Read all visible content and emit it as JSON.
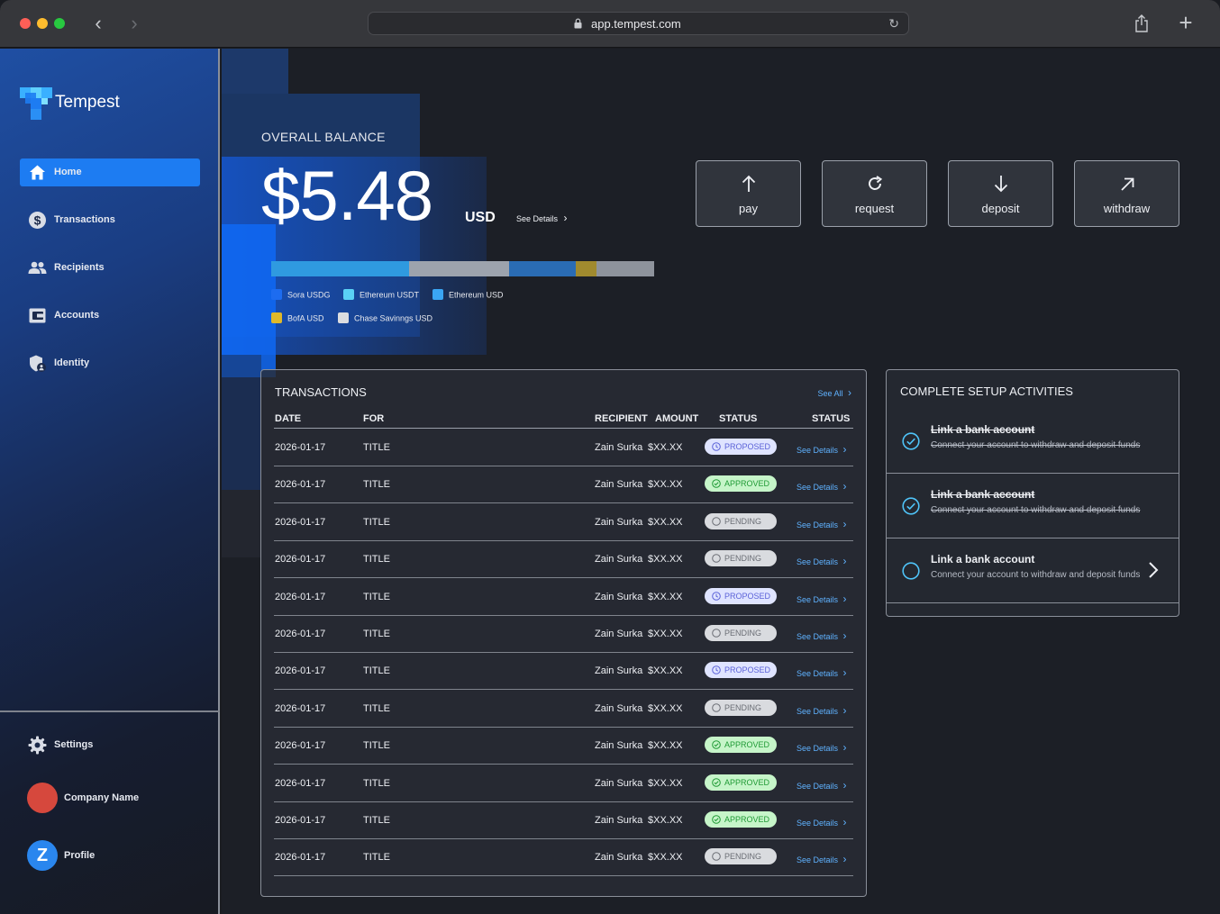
{
  "browser": {
    "url": "app.tempest.com"
  },
  "sidebar": {
    "brand": "Tempest",
    "items": [
      {
        "label": "Home",
        "icon": "home-icon",
        "active": true
      },
      {
        "label": "Transactions",
        "icon": "dollar-icon"
      },
      {
        "label": "Recipients",
        "icon": "people-icon"
      },
      {
        "label": "Accounts",
        "icon": "wallet-icon"
      },
      {
        "label": "Identity",
        "icon": "shield-user-icon"
      }
    ],
    "settings_label": "Settings",
    "company_label": "Company Name",
    "profile_label": "Profile",
    "profile_initial": "Z"
  },
  "balance": {
    "title": "OVERALL BALANCE",
    "amount": "$5.48",
    "currency": "USD",
    "see_details": "See Details",
    "breakdown": [
      {
        "name": "Sora USDG",
        "color": "#2f9ae0",
        "share": 0.36
      },
      {
        "name": "Ethereum USDT",
        "color": "#9da3ad",
        "share": 0.26
      },
      {
        "name": "Ethereum USD",
        "color": "#2a6cb4",
        "share": 0.175
      },
      {
        "name": "BofA USD",
        "color": "#a08a2e",
        "share": 0.055
      },
      {
        "name": "Chase Savinngs USD",
        "color": "#8e939c",
        "share": 0.15
      }
    ],
    "legend_colors": [
      "#1d6cf0",
      "#5ad1f5",
      "#3aa5f3",
      "#e0b92a",
      "#dcdde0"
    ]
  },
  "actions": [
    {
      "label": "pay",
      "icon": "arrow-up-icon"
    },
    {
      "label": "request",
      "icon": "refresh-icon"
    },
    {
      "label": "deposit",
      "icon": "arrow-down-icon"
    },
    {
      "label": "withdraw",
      "icon": "arrow-up-right-icon"
    }
  ],
  "transactions": {
    "title": "TRANSACTIONS",
    "see_all": "See All",
    "headers": {
      "date": "DATE",
      "for": "FOR",
      "recipient": "RECIPIENT",
      "amount": "AMOUNT",
      "status": "STATUS",
      "status2": "STATUS"
    },
    "see_details": "See Details",
    "rows": [
      {
        "date": "2026-01-17",
        "for": "TITLE",
        "recipient": "Zain Surka",
        "amount": "$XX.XX",
        "status": "PROPOSED"
      },
      {
        "date": "2026-01-17",
        "for": "TITLE",
        "recipient": "Zain Surka",
        "amount": "$XX.XX",
        "status": "APPROVED"
      },
      {
        "date": "2026-01-17",
        "for": "TITLE",
        "recipient": "Zain Surka",
        "amount": "$XX.XX",
        "status": "PENDING"
      },
      {
        "date": "2026-01-17",
        "for": "TITLE",
        "recipient": "Zain Surka",
        "amount": "$XX.XX",
        "status": "PENDING"
      },
      {
        "date": "2026-01-17",
        "for": "TITLE",
        "recipient": "Zain Surka",
        "amount": "$XX.XX",
        "status": "PROPOSED"
      },
      {
        "date": "2026-01-17",
        "for": "TITLE",
        "recipient": "Zain Surka",
        "amount": "$XX.XX",
        "status": "PENDING"
      },
      {
        "date": "2026-01-17",
        "for": "TITLE",
        "recipient": "Zain Surka",
        "amount": "$XX.XX",
        "status": "PROPOSED"
      },
      {
        "date": "2026-01-17",
        "for": "TITLE",
        "recipient": "Zain Surka",
        "amount": "$XX.XX",
        "status": "PENDING"
      },
      {
        "date": "2026-01-17",
        "for": "TITLE",
        "recipient": "Zain Surka",
        "amount": "$XX.XX",
        "status": "APPROVED"
      },
      {
        "date": "2026-01-17",
        "for": "TITLE",
        "recipient": "Zain Surka",
        "amount": "$XX.XX",
        "status": "APPROVED"
      },
      {
        "date": "2026-01-17",
        "for": "TITLE",
        "recipient": "Zain Surka",
        "amount": "$XX.XX",
        "status": "APPROVED"
      },
      {
        "date": "2026-01-17",
        "for": "TITLE",
        "recipient": "Zain Surka",
        "amount": "$XX.XX",
        "status": "PENDING"
      }
    ]
  },
  "setup": {
    "title": "COMPLETE SETUP ACTIVITIES",
    "items": [
      {
        "title": "Link a bank account",
        "desc": "Connect your account to withdraw and deposit funds",
        "done": true
      },
      {
        "title": "Link a bank account",
        "desc": "Connect your account to withdraw and deposit funds",
        "done": true
      },
      {
        "title": "Link a bank account",
        "desc": "Connect your account to withdraw and deposit funds",
        "done": false
      }
    ]
  }
}
